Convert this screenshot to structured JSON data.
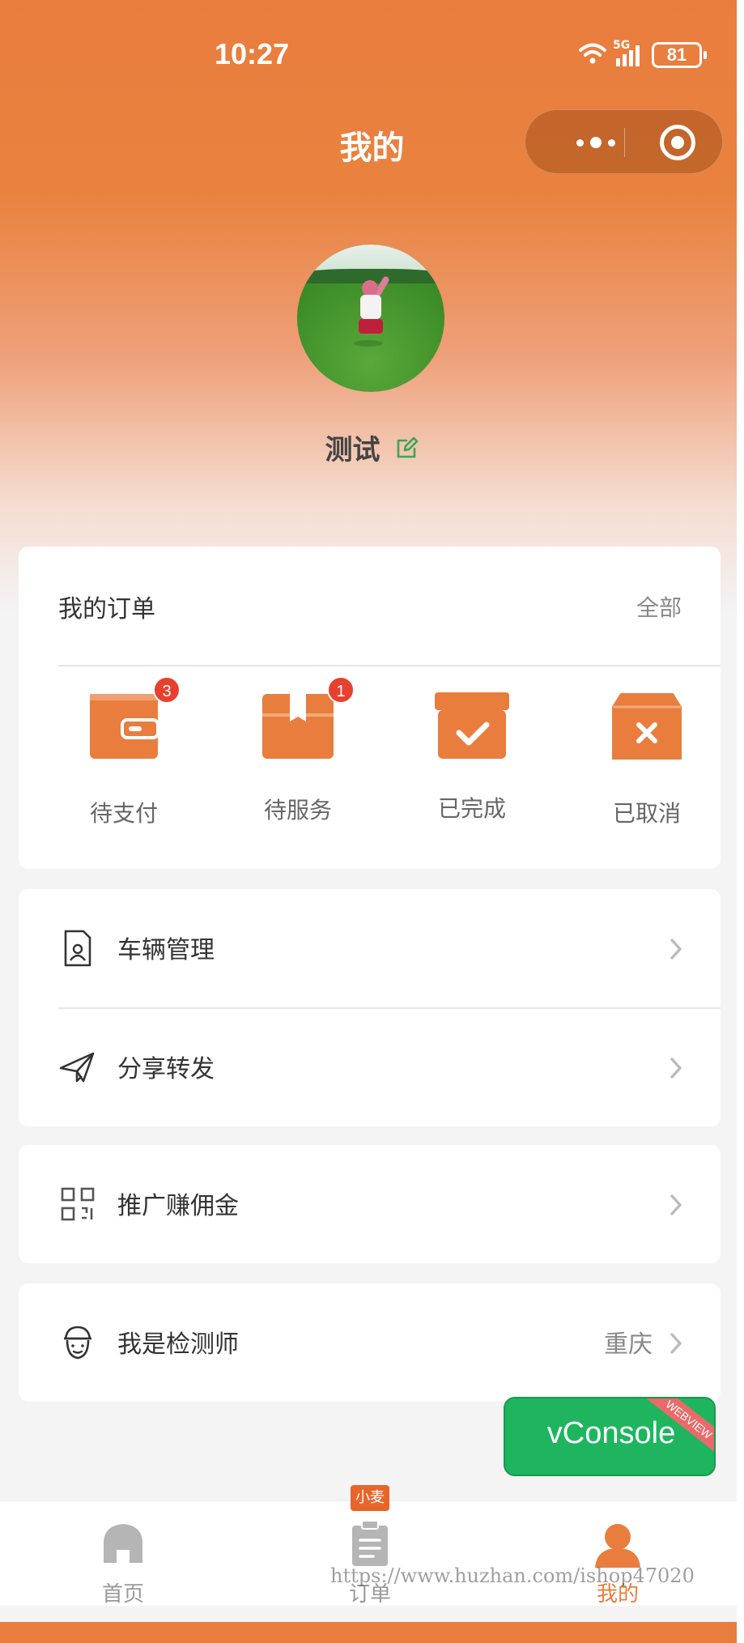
{
  "status_bar": {
    "time": "10:27",
    "network": "5G",
    "battery": "81"
  },
  "nav": {
    "title": "我的"
  },
  "profile": {
    "username": "测试"
  },
  "orders": {
    "title": "我的订单",
    "all_label": "全部",
    "items": [
      {
        "label": "待支付",
        "badge": "3",
        "icon": "wallet-icon"
      },
      {
        "label": "待服务",
        "badge": "1",
        "icon": "package-icon"
      },
      {
        "label": "已完成",
        "badge": "",
        "icon": "box-check-icon"
      },
      {
        "label": "已取消",
        "badge": "",
        "icon": "box-cancel-icon"
      }
    ]
  },
  "menu": {
    "vehicle": {
      "label": "车辆管理",
      "icon": "vehicle-doc-icon"
    },
    "share": {
      "label": "分享转发",
      "icon": "paper-plane-icon"
    },
    "promote": {
      "label": "推广赚佣金",
      "icon": "qrcode-icon"
    },
    "inspector": {
      "label": "我是检测师",
      "value": "重庆",
      "icon": "inspector-icon"
    }
  },
  "vconsole": {
    "label": "vConsole",
    "ribbon": "WEBVIEW"
  },
  "tabbar": {
    "badge": "小麦",
    "tabs": [
      {
        "label": "首页",
        "icon": "home-icon"
      },
      {
        "label": "订单",
        "icon": "clipboard-icon"
      },
      {
        "label": "我的",
        "icon": "user-icon"
      }
    ]
  },
  "watermark": "https://www.huzhan.com/ishop47020",
  "colors": {
    "accent": "#e97d3e",
    "badge": "#e8402f",
    "vconsole": "#1fb55f",
    "edit": "#3aa655"
  }
}
